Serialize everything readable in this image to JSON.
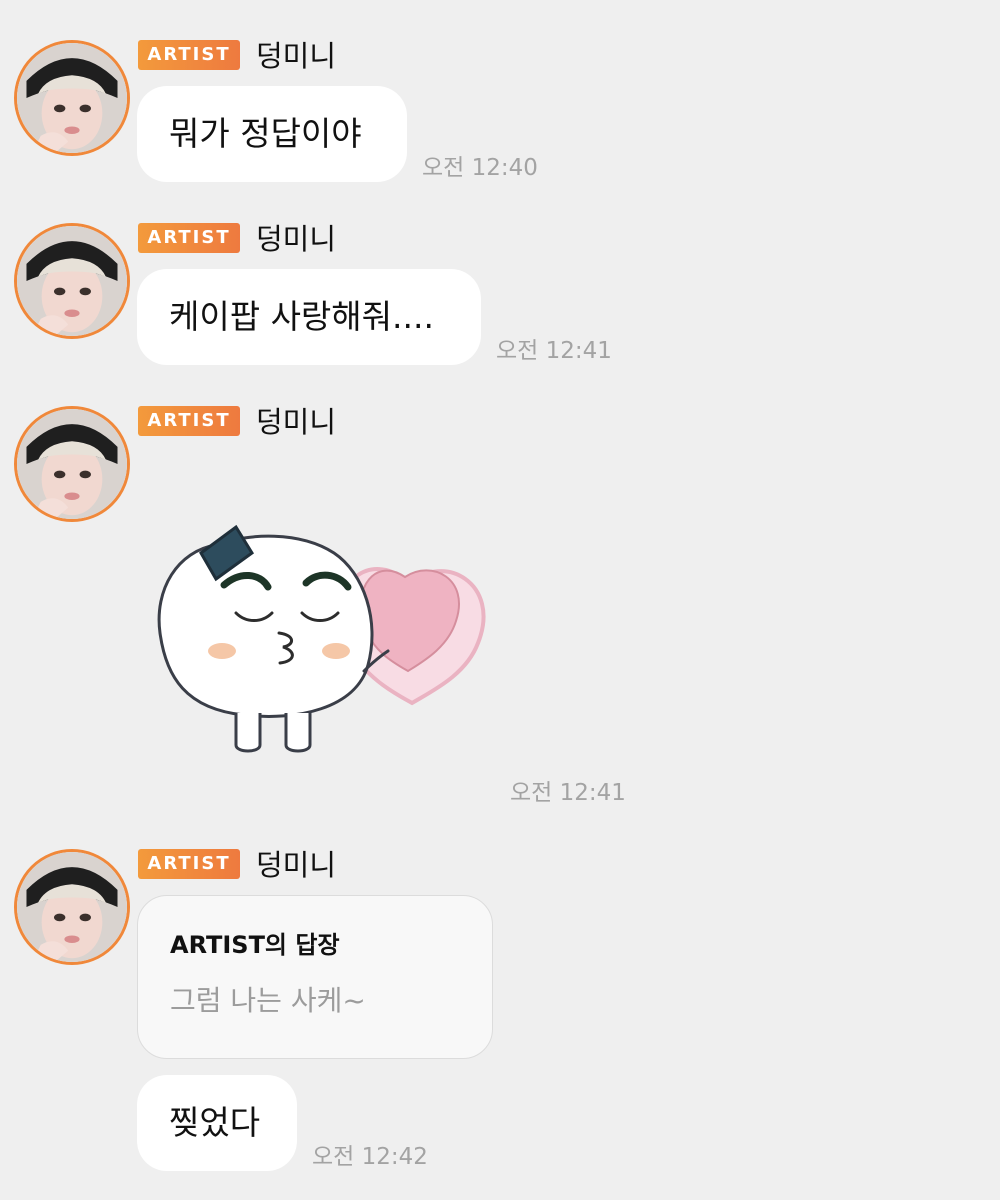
{
  "messages": [
    {
      "badge": "ARTIST",
      "sender": "덩미니",
      "text": "뭐가 정답이야",
      "time": "오전 12:40"
    },
    {
      "badge": "ARTIST",
      "sender": "덩미니",
      "text": "케이팝 사랑해줘....",
      "time": "오전 12:41"
    },
    {
      "badge": "ARTIST",
      "sender": "덩미니",
      "sticker": "rice-ball-kiss-heart-sticker",
      "time": "오전 12:41"
    },
    {
      "badge": "ARTIST",
      "sender": "덩미니",
      "reply": {
        "title": "ARTIST의 답장",
        "text": "그럼 나는 사케~"
      },
      "text": "찢었다",
      "time": "오전 12:42"
    }
  ],
  "colors": {
    "background": "#efefef",
    "bubble": "#ffffff",
    "badge_start": "#f39a3c",
    "badge_end": "#ee7a3f",
    "avatar_ring": "#f0883a",
    "timestamp": "#a3a3a3"
  },
  "icons": {
    "avatar": "profile-photo-avatar",
    "sticker": "rice-ball-kiss-heart-sticker"
  }
}
